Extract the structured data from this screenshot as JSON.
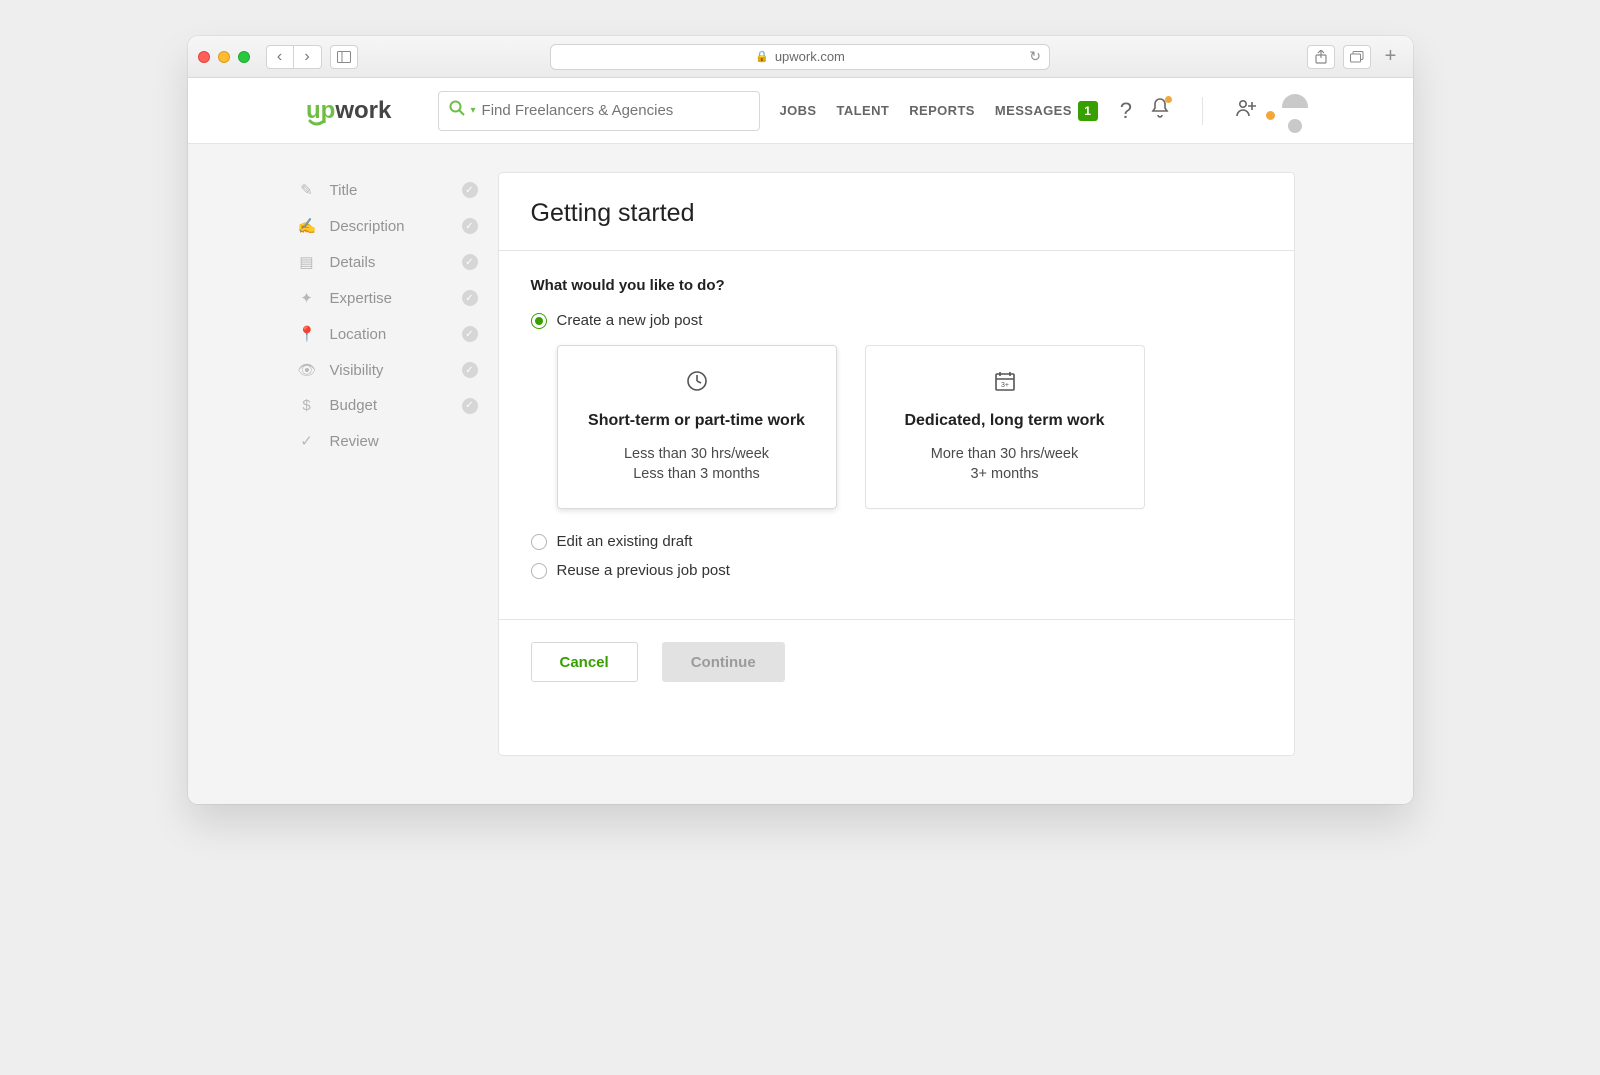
{
  "browser": {
    "url": "upwork.com"
  },
  "topnav": {
    "search_placeholder": "Find Freelancers & Agencies",
    "links": {
      "jobs": "JOBS",
      "talent": "TALENT",
      "reports": "REPORTS",
      "messages": "MESSAGES"
    },
    "messages_badge": "1"
  },
  "sidebar": {
    "steps": [
      {
        "label": "Title"
      },
      {
        "label": "Description"
      },
      {
        "label": "Details"
      },
      {
        "label": "Expertise"
      },
      {
        "label": "Location"
      },
      {
        "label": "Visibility"
      },
      {
        "label": "Budget"
      },
      {
        "label": "Review"
      }
    ]
  },
  "card": {
    "title": "Getting started",
    "question": "What would you like to do?",
    "radios": {
      "create": "Create a new job post",
      "edit": "Edit an existing draft",
      "reuse": "Reuse a previous job post"
    },
    "options": {
      "short": {
        "title": "Short-term or part-time work",
        "line1": "Less than 30 hrs/week",
        "line2": "Less than 3 months"
      },
      "long": {
        "title": "Dedicated, long term work",
        "line1": "More than 30 hrs/week",
        "line2": "3+ months"
      }
    },
    "buttons": {
      "cancel": "Cancel",
      "continue": "Continue"
    }
  }
}
